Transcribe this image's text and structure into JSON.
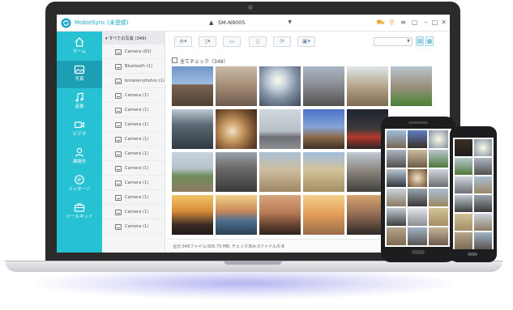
{
  "app": {
    "title": "MobieSync (未登録)",
    "device_name": "SM-N9005",
    "brand_color": "#27c1d4",
    "icons": [
      "cart-icon",
      "key-icon",
      "menu-icon",
      "chat-icon",
      "minimize-icon",
      "maximize-icon",
      "close-icon"
    ]
  },
  "sidebar": {
    "items": [
      {
        "label": "ホーム",
        "icon": "home-icon"
      },
      {
        "label": "写真",
        "icon": "photo-icon",
        "active": true
      },
      {
        "label": "音楽",
        "icon": "music-icon"
      },
      {
        "label": "ビデオ",
        "icon": "video-icon"
      },
      {
        "label": "連絡先",
        "icon": "contacts-icon"
      },
      {
        "label": "メッセージ",
        "icon": "message-icon"
      },
      {
        "label": "ツールキット",
        "icon": "toolbox-icon"
      }
    ]
  },
  "folders": {
    "header": "▾ すべての写真 (349)",
    "items": [
      "Camera (82)",
      "Bluetooth (1)",
      "browser-photos (1)",
      "Camera (1)",
      "Camera (1)",
      "Camera (1)",
      "Camera (1)",
      "Camera (1)",
      "Camera (1)",
      "Camera (1)",
      "Camera (1)",
      "Camera (1)",
      "Camera (1)"
    ]
  },
  "toolbar": {
    "buttons": [
      {
        "name": "add-button",
        "glyph": "⊕▾"
      },
      {
        "name": "export-to-device-button",
        "glyph": "▯▾"
      },
      {
        "name": "export-to-pc-button",
        "glyph": "▭"
      },
      {
        "name": "delete-button",
        "glyph": "▯"
      },
      {
        "name": "refresh-button",
        "glyph": "⟳"
      },
      {
        "name": "toolbox-button",
        "glyph": "▣▾"
      }
    ]
  },
  "check_all_label": "全てチェック（349）",
  "status_text": "合計:349ファイル/305.75 MB; チェック済み:0ファイル/0 B"
}
